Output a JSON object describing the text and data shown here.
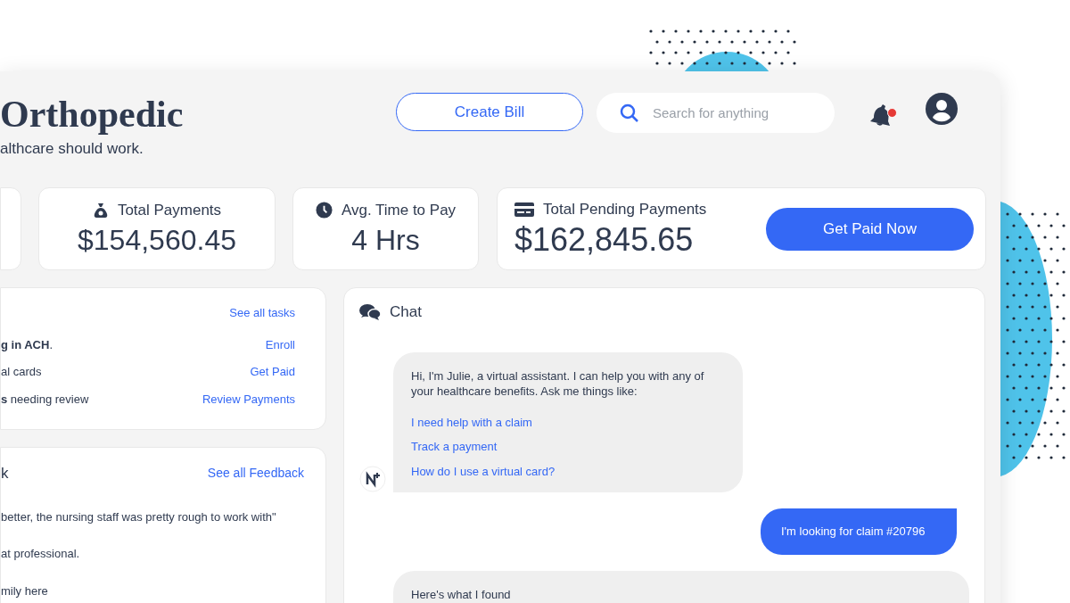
{
  "header": {
    "title": "Orthopedic",
    "tagline": "althcare should work.",
    "create_button": "Create Bill",
    "search": {
      "placeholder": "Search for anything"
    },
    "notifications": {
      "unread": true
    }
  },
  "stats": [
    {
      "kind": "payments",
      "label": "Total Payments",
      "value": "$154,560.45"
    },
    {
      "kind": "time",
      "label": "Avg. Time to Pay",
      "value": "4 Hrs"
    },
    {
      "kind": "pending",
      "label": "Total Pending Payments",
      "value": "$162,845.65",
      "action": "Get Paid Now"
    }
  ],
  "tasks": {
    "link": "See all tasks",
    "items": [
      {
        "text": "**g in ACH**.",
        "action": "Enroll"
      },
      {
        "text": "al cards",
        "action": "Get Paid"
      },
      {
        "text": "**s** needing review",
        "action": "Review Payments"
      }
    ]
  },
  "feedback": {
    "title": "k",
    "link": "See all Feedback",
    "items": [
      "better, the nursing staff was pretty rough to work with\"",
      "at professional.",
      "mily here"
    ]
  },
  "chat": {
    "title": "Chat",
    "messages": [
      {
        "kind": "bot",
        "text": "Hi, I'm Julie, a virtual assistant. I can help you with any of your healthcare benefits. Ask me things like:",
        "suggestions": [
          "I need help with a claim",
          "Track a payment",
          "How do I use a virtual card?"
        ]
      },
      {
        "kind": "user",
        "text": "I'm looking for claim #20796"
      },
      {
        "kind": "bot",
        "text": "Here's what I found"
      }
    ]
  }
}
